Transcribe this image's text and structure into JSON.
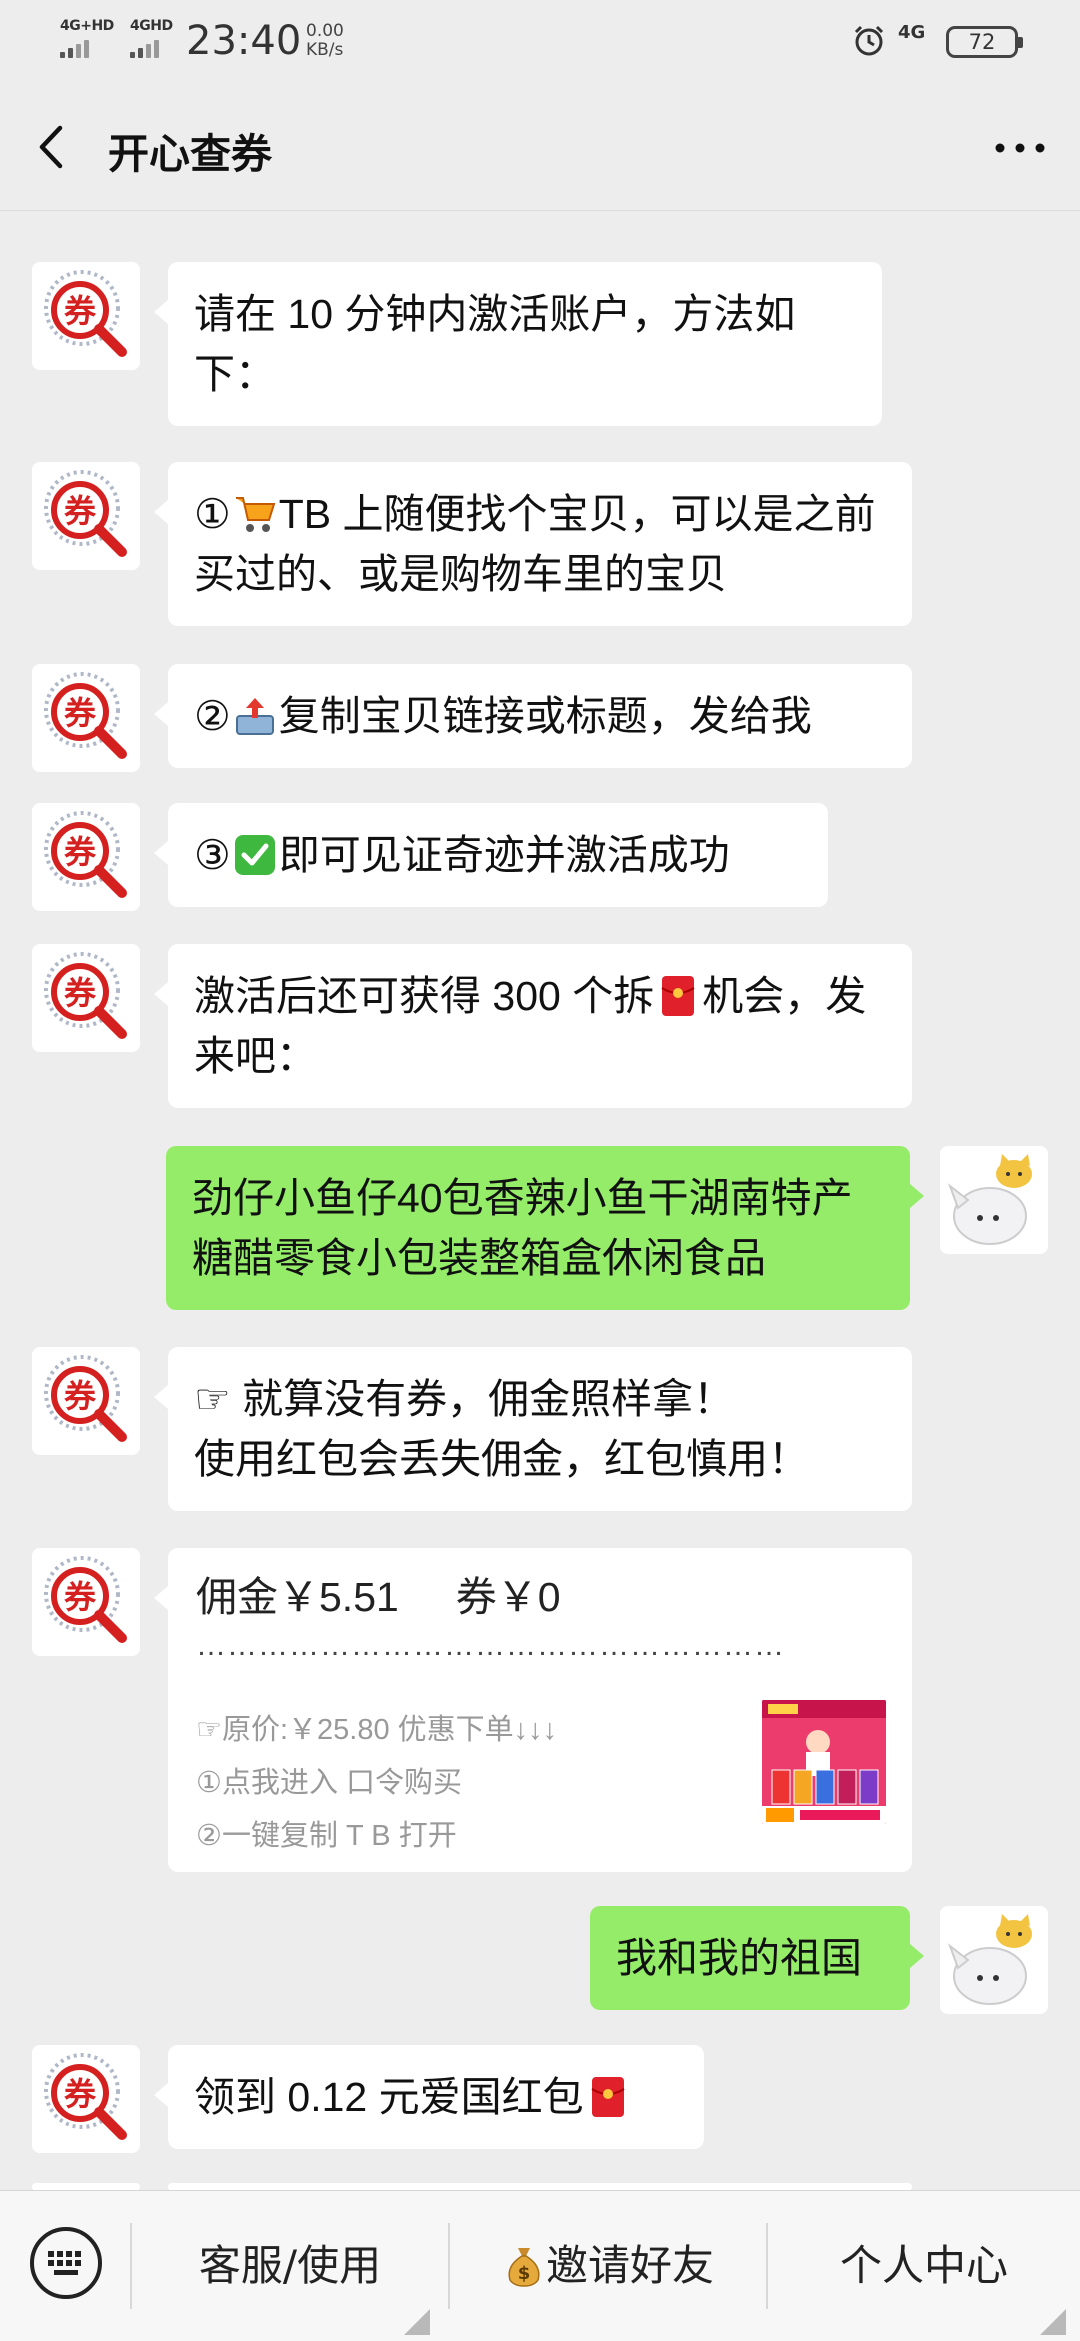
{
  "status_bar": {
    "net1": "4G+HD",
    "net2": "4GHD",
    "time": "23:40",
    "speed_value": "0.00",
    "speed_unit": "KB/s",
    "net_right": "4G",
    "battery": "72"
  },
  "header": {
    "title": "开心查券"
  },
  "avatar_left_text": "券",
  "messages": [
    {
      "side": "left",
      "text": "请在 10 分钟内激活账户，方法如下："
    },
    {
      "side": "left",
      "pre": "①",
      "emoji": "cart-emoji",
      "text": "TB 上随便找个宝贝，可以是之前买过的、或是购物车里的宝贝"
    },
    {
      "side": "left",
      "pre": "②",
      "emoji": "outbox-emoji",
      "text": "复制宝贝链接或标题，发给我"
    },
    {
      "side": "left",
      "pre": "③",
      "emoji": "check-emoji",
      "text": "即可见证奇迹并激活成功"
    },
    {
      "side": "left",
      "text_a": "激活后还可获得 300 个拆",
      "emoji": "red-envelope-emoji",
      "text_b": "机会，发来吧："
    },
    {
      "side": "right",
      "text": "劲仔小鱼仔40包香辣小鱼干湖南特产糖醋零食小包装整箱盒休闲食品"
    },
    {
      "side": "left",
      "line1": "☞ 就算没有券，佣金照样拿！",
      "line2": "使用红包会丢失佣金，红包慎用！"
    },
    {
      "side": "left",
      "card": {
        "commission": "佣金￥5.51",
        "coupon": "券￥0",
        "dots": "…………………………………………………",
        "line1": "☞原价:￥25.80   优惠下单↓↓↓",
        "line2": "①点我进入   口令购买",
        "line3": "②一键复制    T B 打开",
        "thumb_label": "product-thumbnail"
      }
    },
    {
      "side": "right",
      "text": "我和我的祖国"
    },
    {
      "side": "left",
      "text": "领到 0.12 元爱国红包",
      "emoji": "red-envelope-emoji"
    }
  ],
  "bottom_bar": {
    "tab1": "客服/使用",
    "tab2": "邀请好友",
    "tab2_icon": "money-bag-icon",
    "tab3": "个人中心"
  }
}
